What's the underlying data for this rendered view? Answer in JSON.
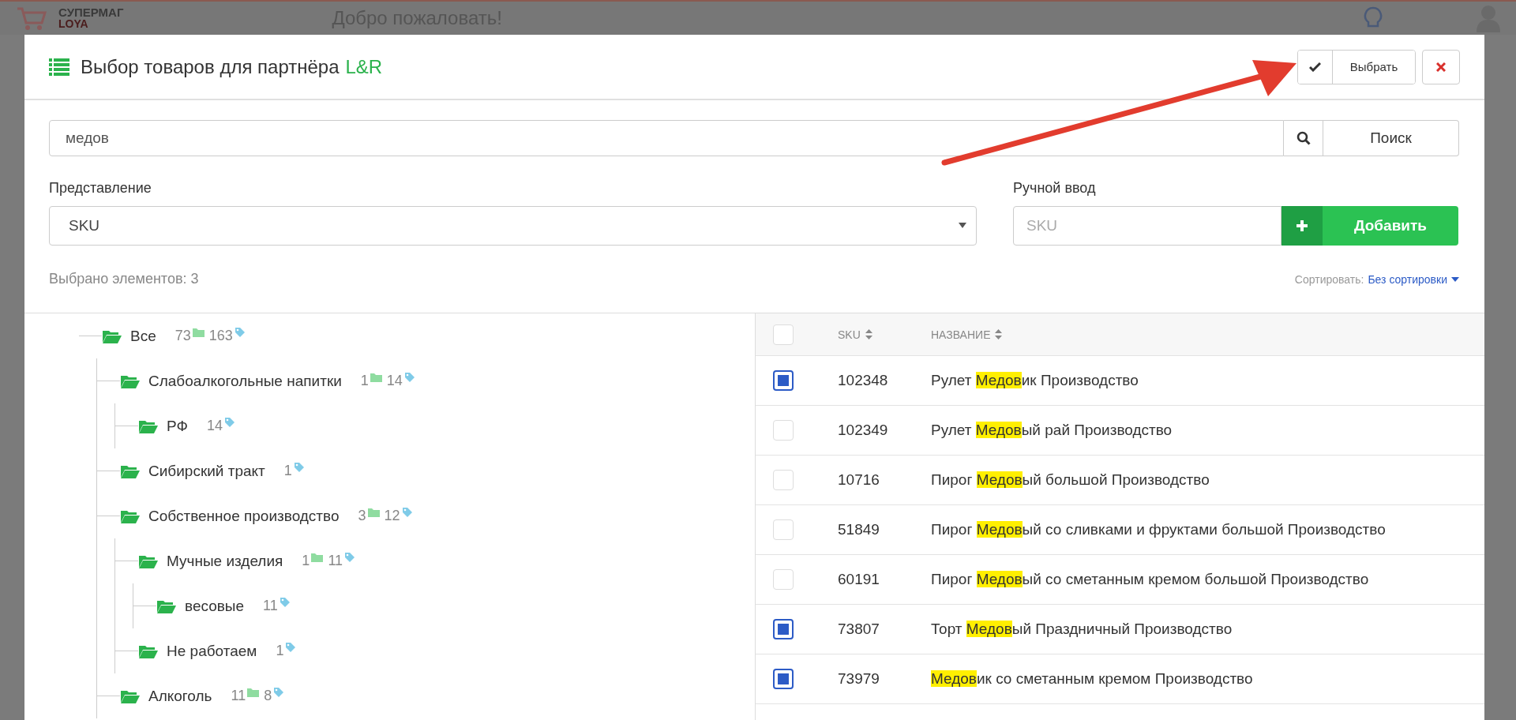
{
  "app": {
    "logo_top": "СУПЕРМАГ",
    "logo_bottom": "LOYA",
    "greeting": "Добро пожаловать!"
  },
  "modal": {
    "title": "Выбор товаров для партнёра",
    "partner": "L&R",
    "select_button": "Выбрать"
  },
  "search": {
    "value": "медов",
    "button": "Поиск"
  },
  "view": {
    "label": "Представление",
    "value": "SKU"
  },
  "manual_input": {
    "label": "Ручной ввод",
    "placeholder": "SKU",
    "button": "Добавить"
  },
  "selected_count": "Выбрано элементов: 3",
  "sort": {
    "label": "Сортировать:",
    "value": "Без сортировки"
  },
  "tree": [
    {
      "label": "Все",
      "folders": "73",
      "items": "163",
      "children": [
        {
          "label": "Слабоалкогольные напитки",
          "folders": "1",
          "items": "14",
          "children": [
            {
              "label": "РФ",
              "items": "14"
            }
          ]
        },
        {
          "label": "Сибирский тракт",
          "items": "1"
        },
        {
          "label": "Собственное производство",
          "folders": "3",
          "items": "12",
          "children": [
            {
              "label": "Мучные изделия",
              "folders": "1",
              "items": "11",
              "children": [
                {
                  "label": "весовые",
                  "items": "11"
                }
              ]
            },
            {
              "label": "Не работаем",
              "items": "1"
            }
          ]
        },
        {
          "label": "Алкоголь",
          "folders": "11",
          "items": "8"
        }
      ]
    }
  ],
  "table": {
    "select_all": false,
    "columns": [
      "SKU",
      "НАЗВАНИЕ"
    ],
    "rows": [
      {
        "sku": "102348",
        "name_before": "Рулет ",
        "name_match": "Медов",
        "name_after": "ик Производство",
        "selected": true
      },
      {
        "sku": "102349",
        "name_before": "Рулет ",
        "name_match": "Медов",
        "name_after": "ый рай Производство",
        "selected": false
      },
      {
        "sku": "10716",
        "name_before": "Пирог ",
        "name_match": "Медов",
        "name_after": "ый большой Производство",
        "selected": false
      },
      {
        "sku": "51849",
        "name_before": "Пирог ",
        "name_match": "Медов",
        "name_after": "ый со сливками и фруктами большой Производство",
        "selected": false
      },
      {
        "sku": "60191",
        "name_before": "Пирог ",
        "name_match": "Медов",
        "name_after": "ый со сметанным кремом большой Производство",
        "selected": false
      },
      {
        "sku": "73807",
        "name_before": "Торт ",
        "name_match": "Медов",
        "name_after": "ый Праздничный Производство",
        "selected": true
      },
      {
        "sku": "73979",
        "name_before": "",
        "name_match": "Медов",
        "name_after": "ик со сметанным кремом Производство",
        "selected": true
      }
    ]
  }
}
